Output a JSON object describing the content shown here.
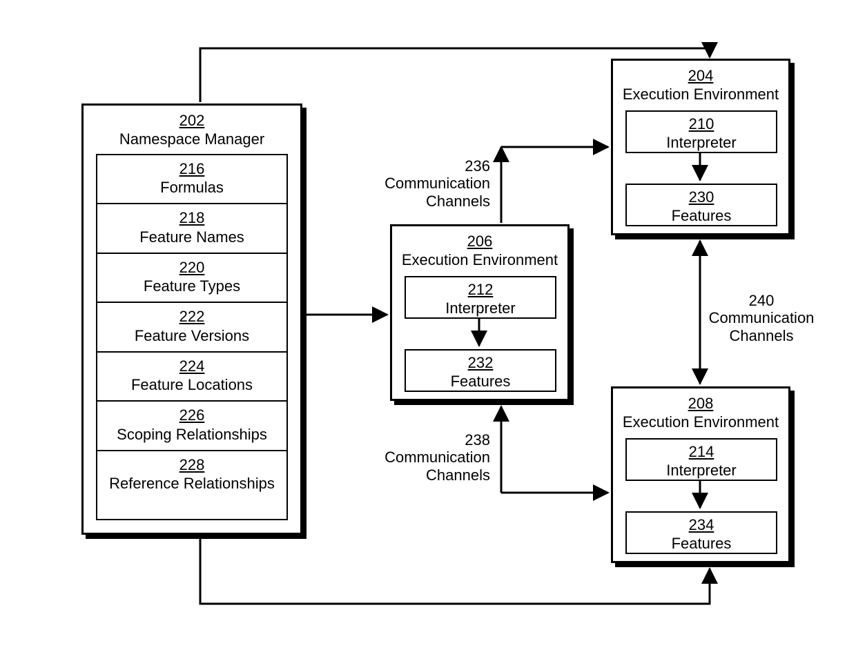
{
  "namespace_manager": {
    "ref": "202",
    "title": "Namespace Manager",
    "items": [
      {
        "ref": "216",
        "label": "Formulas"
      },
      {
        "ref": "218",
        "label": "Feature Names"
      },
      {
        "ref": "220",
        "label": "Feature Types"
      },
      {
        "ref": "222",
        "label": "Feature Versions"
      },
      {
        "ref": "224",
        "label": "Feature Locations"
      },
      {
        "ref": "226",
        "label": "Scoping Relationships"
      },
      {
        "ref": "228",
        "label": "Reference Relationships"
      }
    ]
  },
  "env1": {
    "ref": "204",
    "title": "Execution Environment",
    "interpreter": {
      "ref": "210",
      "label": "Interpreter"
    },
    "features": {
      "ref": "230",
      "label": "Features"
    }
  },
  "env2": {
    "ref": "206",
    "title": "Execution Environment",
    "interpreter": {
      "ref": "212",
      "label": "Interpreter"
    },
    "features": {
      "ref": "232",
      "label": "Features"
    }
  },
  "env3": {
    "ref": "208",
    "title": "Execution Environment",
    "interpreter": {
      "ref": "214",
      "label": "Interpreter"
    },
    "features": {
      "ref": "234",
      "label": "Features"
    }
  },
  "channels": {
    "c236": {
      "ref": "236",
      "label_l1": "Communication",
      "label_l2": "Channels"
    },
    "c238": {
      "ref": "238",
      "label_l1": "Communication",
      "label_l2": "Channels"
    },
    "c240": {
      "ref": "240",
      "label_l1": "Communication",
      "label_l2": "Channels"
    }
  }
}
